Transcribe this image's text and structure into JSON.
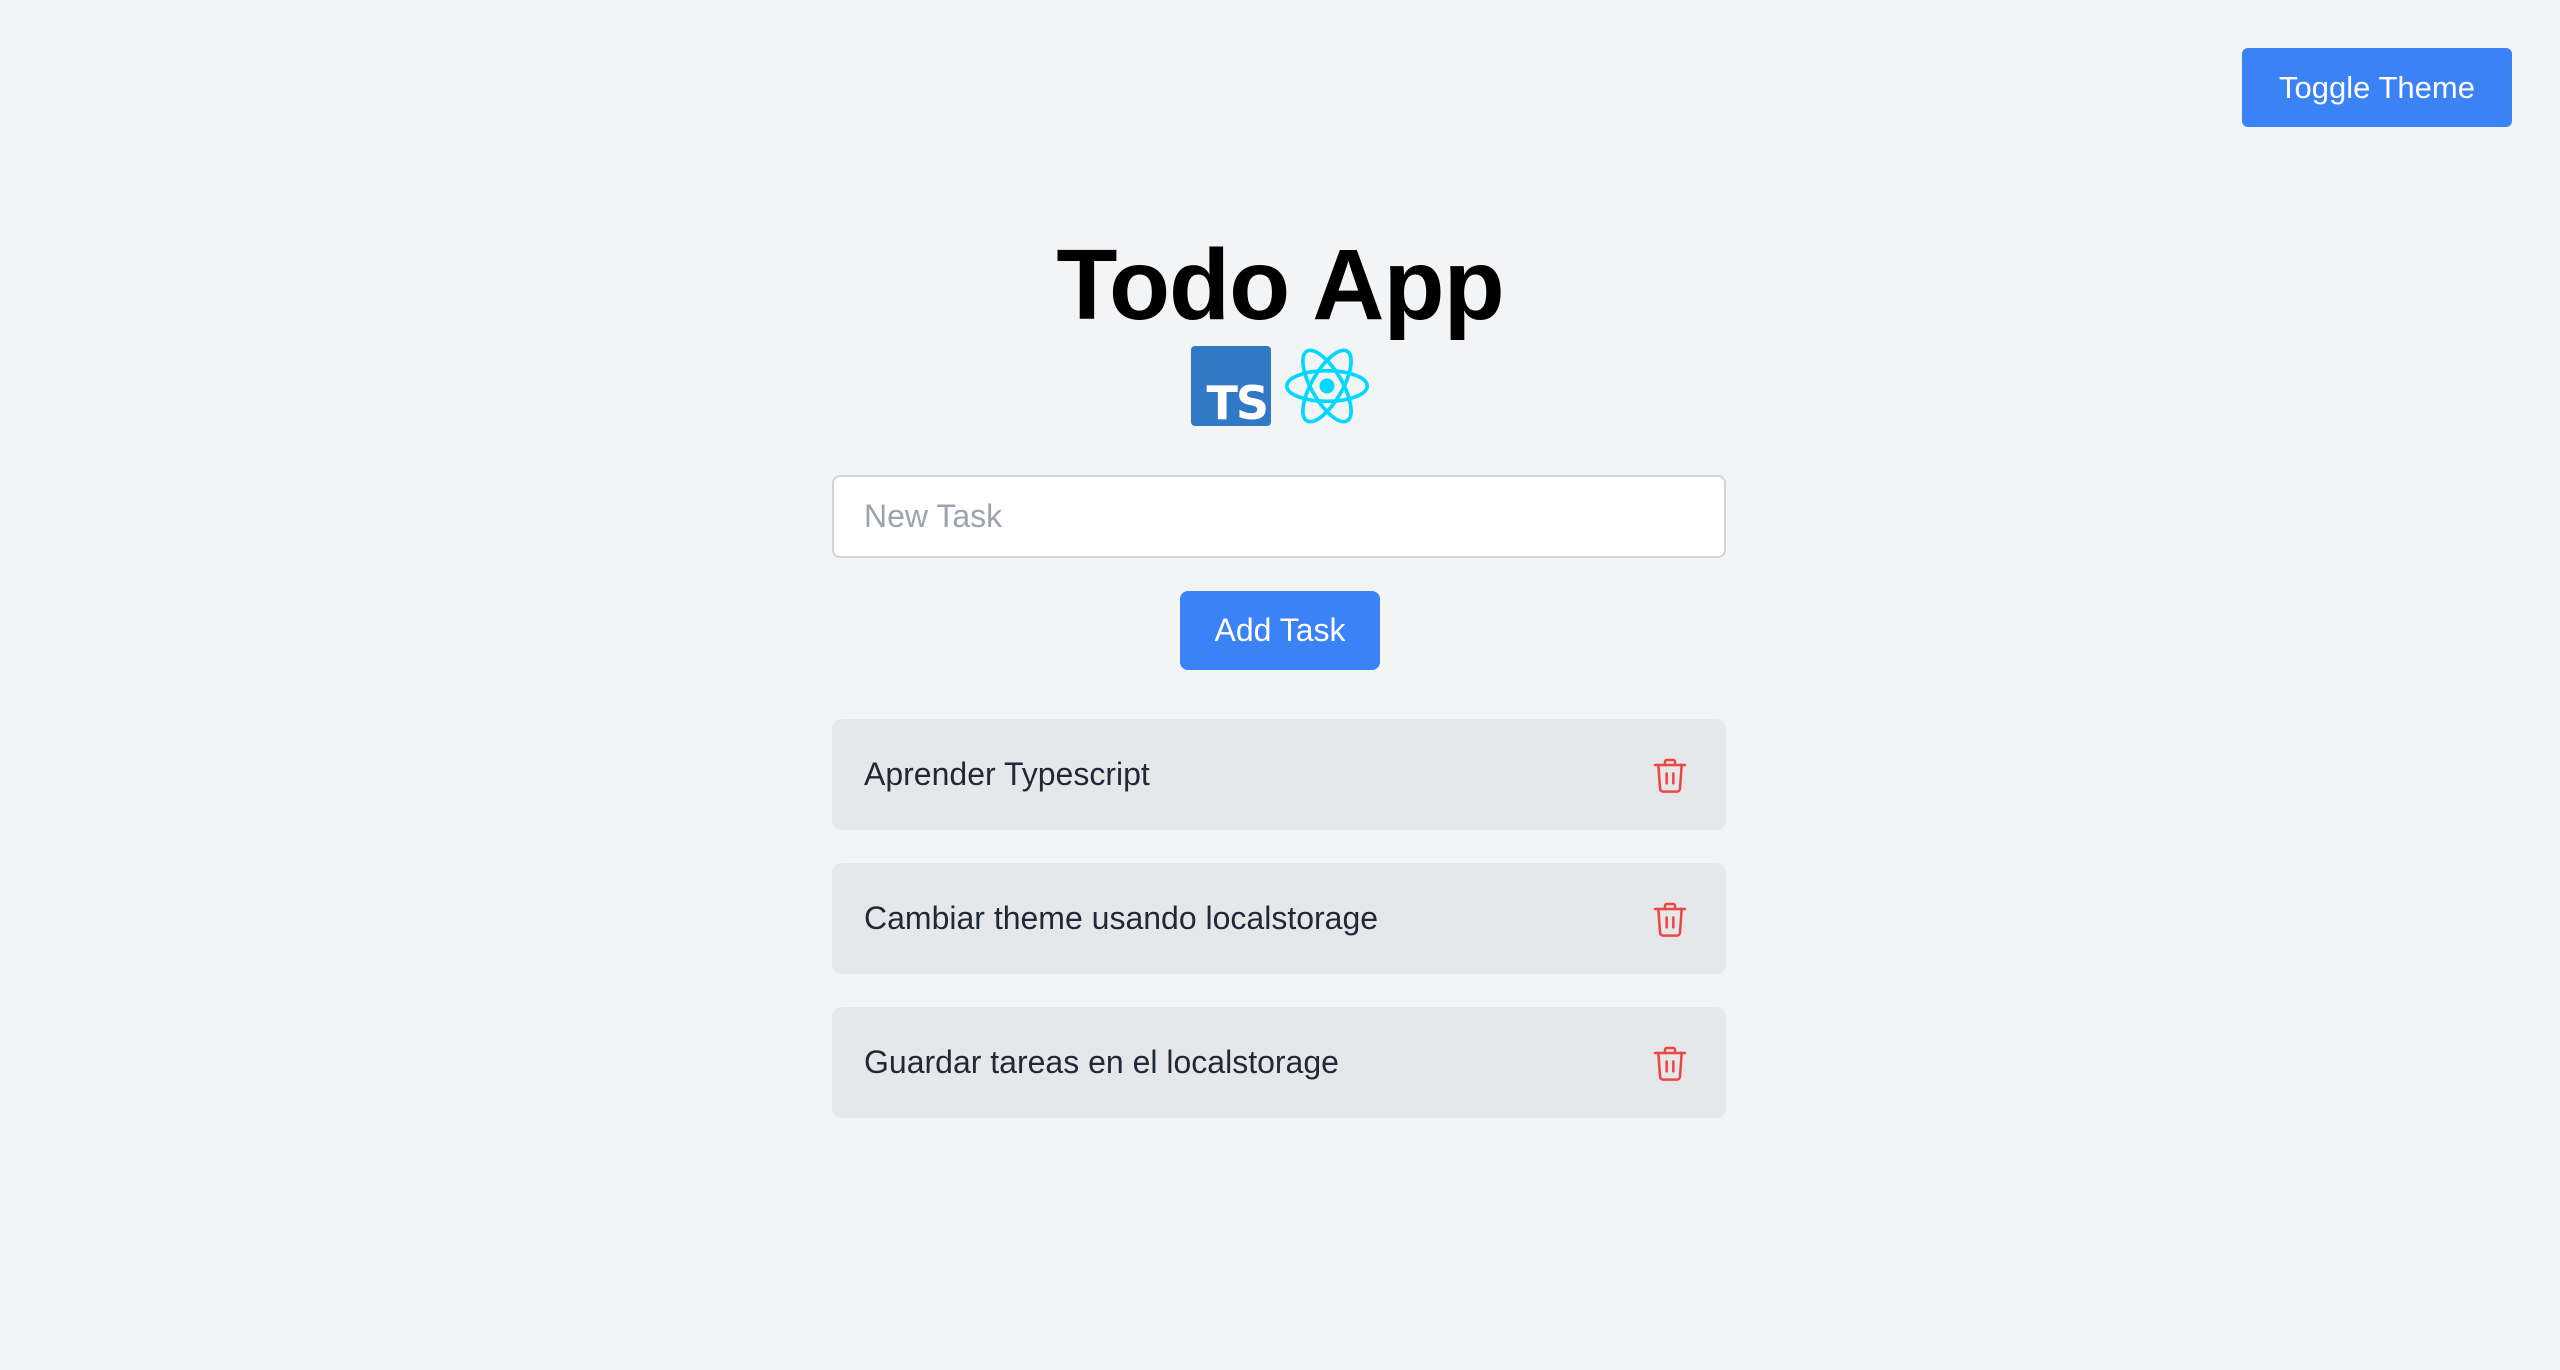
{
  "header": {
    "toggle_theme_label": "Toggle Theme"
  },
  "main": {
    "title": "Todo App",
    "logos": [
      {
        "icon": "typescript-logo",
        "text": "TS"
      },
      {
        "icon": "react-logo"
      }
    ],
    "input_placeholder": "New Task",
    "input_value": "",
    "add_button_label": "Add Task"
  },
  "tasks": [
    {
      "text": "Aprender Typescript"
    },
    {
      "text": "Cambiar theme usando localstorage"
    },
    {
      "text": "Guardar tareas en el localstorage"
    }
  ],
  "colors": {
    "background": "#f3f4f6",
    "accent": "#3b82f6",
    "task_bg": "#e5e7eb",
    "delete": "#ef4444",
    "typescript": "#3178c6",
    "react": "#00d8ff"
  }
}
